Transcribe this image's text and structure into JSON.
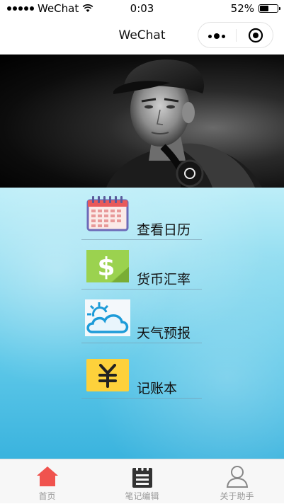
{
  "status_bar": {
    "carrier": "WeChat",
    "time": "0:03",
    "battery": "52%",
    "battery_level": 0.52
  },
  "nav": {
    "title": "WeChat"
  },
  "menu": [
    {
      "label": "查看日历",
      "icon": "calendar-icon"
    },
    {
      "label": "货币汇率",
      "icon": "dollar-icon"
    },
    {
      "label": "天气预报",
      "icon": "weather-icon"
    },
    {
      "label": "记账本",
      "icon": "yen-icon"
    }
  ],
  "tabs": [
    {
      "label": "首页",
      "icon": "home-icon",
      "active": true
    },
    {
      "label": "笔记编辑",
      "icon": "notebook-icon",
      "active": false
    },
    {
      "label": "关于助手",
      "icon": "user-icon",
      "active": false
    }
  ],
  "colors": {
    "active_tab": "#f0534e",
    "inactive_tab": "#999999"
  }
}
